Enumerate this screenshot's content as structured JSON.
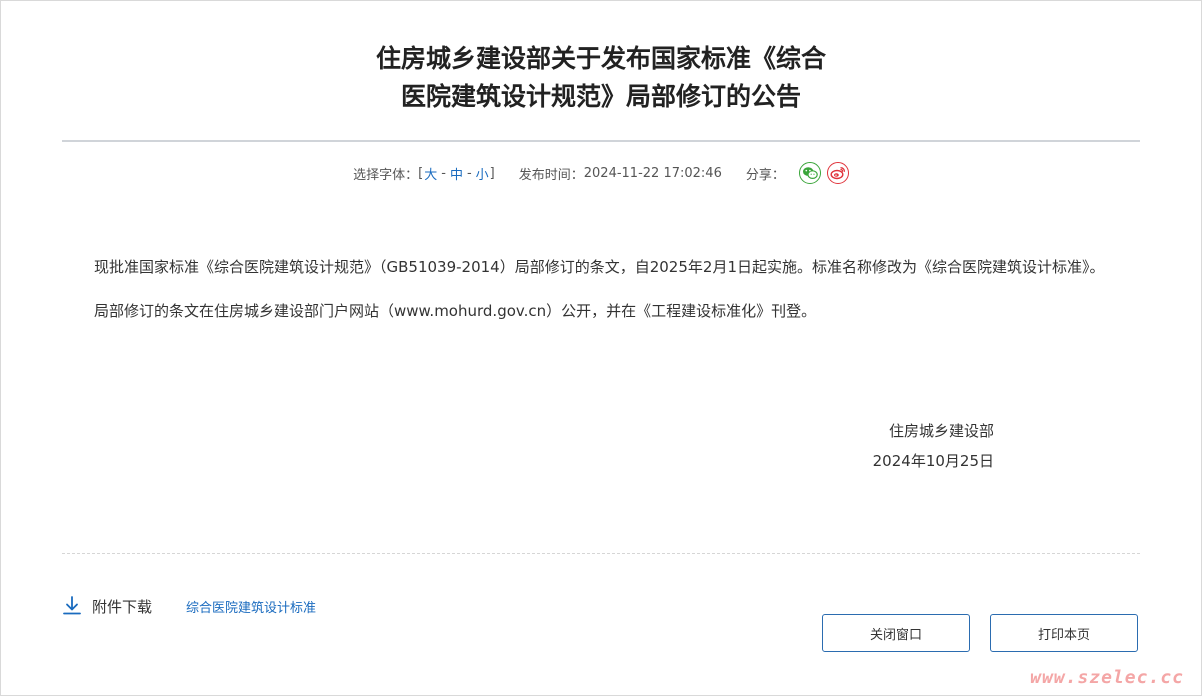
{
  "article": {
    "title_line1": "住房城乡建设部关于发布国家标准《综合",
    "title_line2": "医院建筑设计规范》局部修订的公告",
    "meta": {
      "font_label": "选择字体：",
      "bracket_open": "[",
      "bracket_close": "]",
      "size_large": "大",
      "size_medium": "中",
      "size_small": "小",
      "dash": "-",
      "publish_label": "发布时间：",
      "publish_time": "2024-11-22 17:02:46",
      "share_label": "分享："
    },
    "paragraphs": [
      "现批准国家标准《综合医院建筑设计规范》（GB51039-2014）局部修订的条文，自2025年2月1日起实施。标准名称修改为《综合医院建筑设计标准》。",
      "局部修订的条文在住房城乡建设部门户网站（www.mohurd.gov.cn）公开，并在《工程建设标准化》刊登。"
    ],
    "signature": {
      "org": "住房城乡建设部",
      "date": "2024年10月25日"
    }
  },
  "attachment": {
    "label": "附件下载",
    "file_name": "综合医院建筑设计标准"
  },
  "buttons": {
    "close_label": "关闭窗口",
    "print_label": "打印本页"
  },
  "watermark": "www.szelec.cc",
  "colors": {
    "link": "#1a6bbf",
    "button_border": "#2b6cb0",
    "wechat": "#3aa53a",
    "weibo": "#e0333b"
  },
  "icons": {
    "wechat": "wechat-icon",
    "weibo": "weibo-icon",
    "download": "download-icon"
  }
}
